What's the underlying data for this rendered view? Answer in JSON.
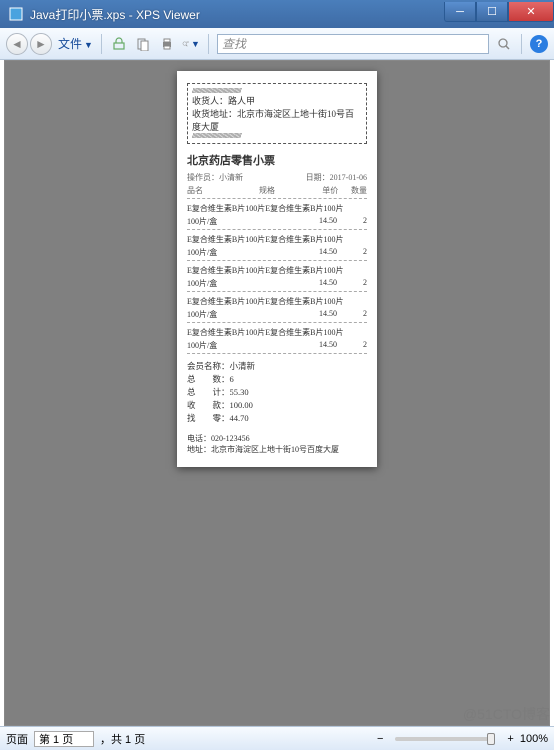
{
  "window": {
    "title": "Java打印小票.xps - XPS Viewer"
  },
  "toolbar": {
    "file": "文件",
    "search_placeholder": "查找"
  },
  "receipt": {
    "box": {
      "recipient_label": "收货人：",
      "recipient": "路人甲",
      "address_label": "收货地址：",
      "address": "北京市海淀区上地十街10号百度大厦"
    },
    "title": "北京药店零售小票",
    "operator_label": "操作员：",
    "operator": "小清新",
    "date_label": "日期：",
    "date": "2017-01-06",
    "cols": {
      "c1": "品名",
      "c2": "规格",
      "c3": "单价",
      "c4": "数量"
    },
    "items": [
      {
        "name": "E复合维生素B片100片E复合维生素B片100片",
        "spec": "100片/盒",
        "price": "14.50",
        "qty": "2"
      },
      {
        "name": "E复合维生素B片100片E复合维生素B片100片",
        "spec": "100片/盒",
        "price": "14.50",
        "qty": "2"
      },
      {
        "name": "E复合维生素B片100片E复合维生素B片100片",
        "spec": "100片/盒",
        "price": "14.50",
        "qty": "2"
      },
      {
        "name": "E复合维生素B片100片E复合维生素B片100片",
        "spec": "100片/盒",
        "price": "14.50",
        "qty": "2"
      },
      {
        "name": "E复合维生素B片100片E复合维生素B片100片",
        "spec": "100片/盒",
        "price": "14.50",
        "qty": "2"
      }
    ],
    "member_label": "会员名称：",
    "member": "小清新",
    "count_label": "总　　数：",
    "count": "6",
    "total_label": "总　　计：",
    "total": "55.30",
    "paid_label": "收　　款：",
    "paid": "100.00",
    "change_label": "找　　零：",
    "change": "44.70",
    "tel_label": "电话：",
    "tel": "020-123456",
    "addr2_label": "地址：",
    "addr2": "北京市海淀区上地十街10号百度大厦"
  },
  "status": {
    "page_label": "页面",
    "page_value": "第 1 页",
    "page_total": "，共 1 页",
    "zoom": "100%"
  },
  "watermark": "@51CTO博客"
}
